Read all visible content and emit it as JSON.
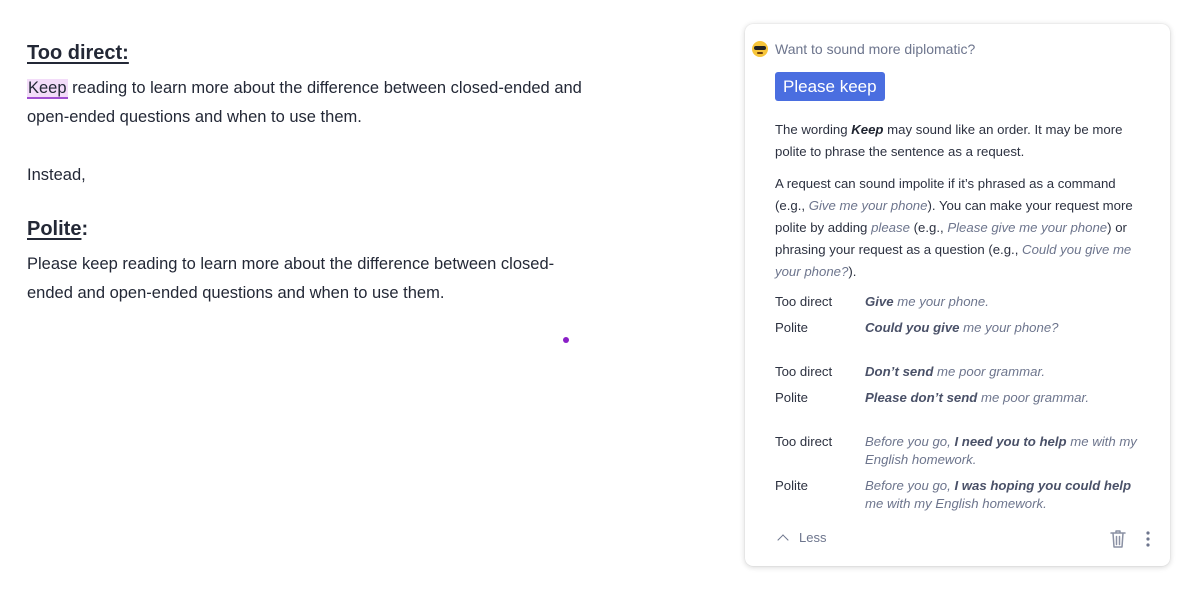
{
  "document": {
    "heading_direct": "Too direct:",
    "para_direct_keep": "Keep",
    "para_direct_rest": " reading to learn more about the difference between closed-ended and open-ended questions and when to use them.",
    "instead": "Instead,",
    "heading_polite_word": "Polite",
    "heading_polite_colon": ":",
    "para_polite": "Please keep reading to learn more about the difference between closed-ended and open-ended questions and when to use them."
  },
  "card": {
    "header": "Want to sound more diplomatic?",
    "header_icon": "sunglasses-emoji-icon",
    "suggestion_label": "Please keep",
    "accent_color": "#4a6ee0",
    "p1_a": "The wording ",
    "p1_b": "Keep",
    "p1_c": " may sound like an order. It may be more polite to phrase the sentence as a request.",
    "p2_a": "A request can sound impolite if it’s phrased as a command (e.g., ",
    "p2_b": "Give me your phone",
    "p2_c": "). You can make your request more polite by adding ",
    "p2_d": "please",
    "p2_e": " (e.g., ",
    "p2_f": "Please give me your phone",
    "p2_g": ") or phrasing your request as a question (e.g., ",
    "p2_h": "Could you give me your phone?",
    "p2_i": ").",
    "examples": [
      {
        "label": "Too direct",
        "bold": "Give",
        "rest": " me your phone."
      },
      {
        "label": "Polite",
        "bold": "Could you give",
        "rest": " me your phone?"
      },
      {
        "label": "Too direct",
        "bold": "Don’t send",
        "rest": " me poor grammar."
      },
      {
        "label": "Polite",
        "bold": "Please don’t send",
        "rest": " me poor grammar."
      },
      {
        "label": "Too direct",
        "pre": "Before you go, ",
        "bold": "I need you to help",
        "rest": " me with my English homework."
      },
      {
        "label": "Polite",
        "pre": "Before you go, ",
        "bold": "I was hoping you could help",
        "rest": " me with my English homework."
      }
    ],
    "less_label": "Less",
    "delete_icon": "trash-icon",
    "more_icon": "more-vertical-icon"
  }
}
